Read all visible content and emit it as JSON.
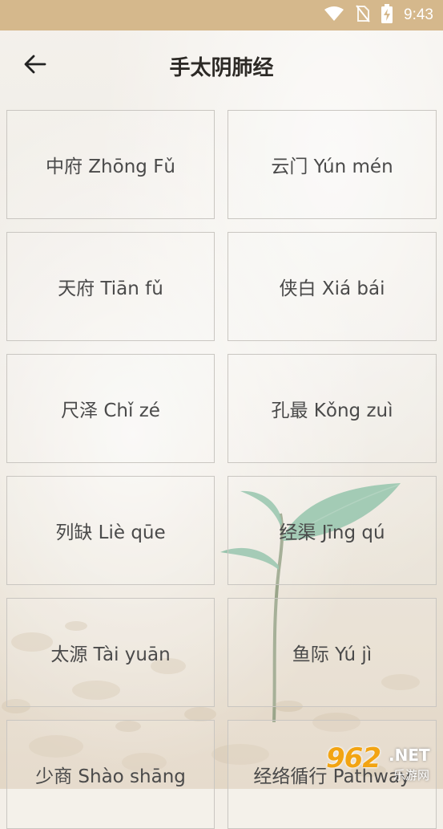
{
  "status_bar": {
    "time": "9:43",
    "icons": [
      "wifi-icon",
      "no-sim-icon",
      "battery-charging-icon"
    ]
  },
  "header": {
    "back_icon": "arrow-left-icon",
    "title": "手太阴肺经"
  },
  "points": [
    {
      "label": "中府 Zhōng Fǔ"
    },
    {
      "label": "云门 Yún mén"
    },
    {
      "label": "天府 Tiān fǔ"
    },
    {
      "label": "侠白 Xiá bái"
    },
    {
      "label": "尺泽 Chǐ zé"
    },
    {
      "label": "孔最 Kǒng zuì"
    },
    {
      "label": "列缺 Liè qūe"
    },
    {
      "label": "经渠 Jīng qú"
    },
    {
      "label": "太源 Tài yuān"
    },
    {
      "label": "鱼际 Yú jì"
    },
    {
      "label": "少商 Shào shāng"
    },
    {
      "label": "经络循行 Pathway"
    }
  ],
  "watermark": {
    "number": "962",
    "domain": ".NET",
    "subtitle": "乐游网"
  },
  "colors": {
    "status_bar": "#d5b88c",
    "title_text": "#2d2a26",
    "card_border": "#c9c6c1",
    "label_text": "#4a4a4a",
    "leaf_green": "#8fc0a6"
  }
}
